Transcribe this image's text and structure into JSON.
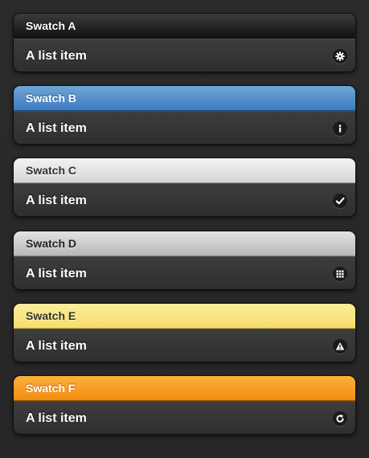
{
  "swatches": [
    {
      "title": "Swatch A",
      "item_label": "A list item",
      "icon": "gear-icon",
      "accent": "#1a1a1a"
    },
    {
      "title": "Swatch B",
      "item_label": "A list item",
      "icon": "info-icon",
      "accent": "#4a88c8"
    },
    {
      "title": "Swatch C",
      "item_label": "A list item",
      "icon": "check-icon",
      "accent": "#e6e6e6"
    },
    {
      "title": "Swatch D",
      "item_label": "A list item",
      "icon": "grid-icon",
      "accent": "#c8c8c8"
    },
    {
      "title": "Swatch E",
      "item_label": "A list item",
      "icon": "alert-icon",
      "accent": "#fbe48a"
    },
    {
      "title": "Swatch F",
      "item_label": "A list item",
      "icon": "refresh-icon",
      "accent": "#f7a02a"
    }
  ]
}
